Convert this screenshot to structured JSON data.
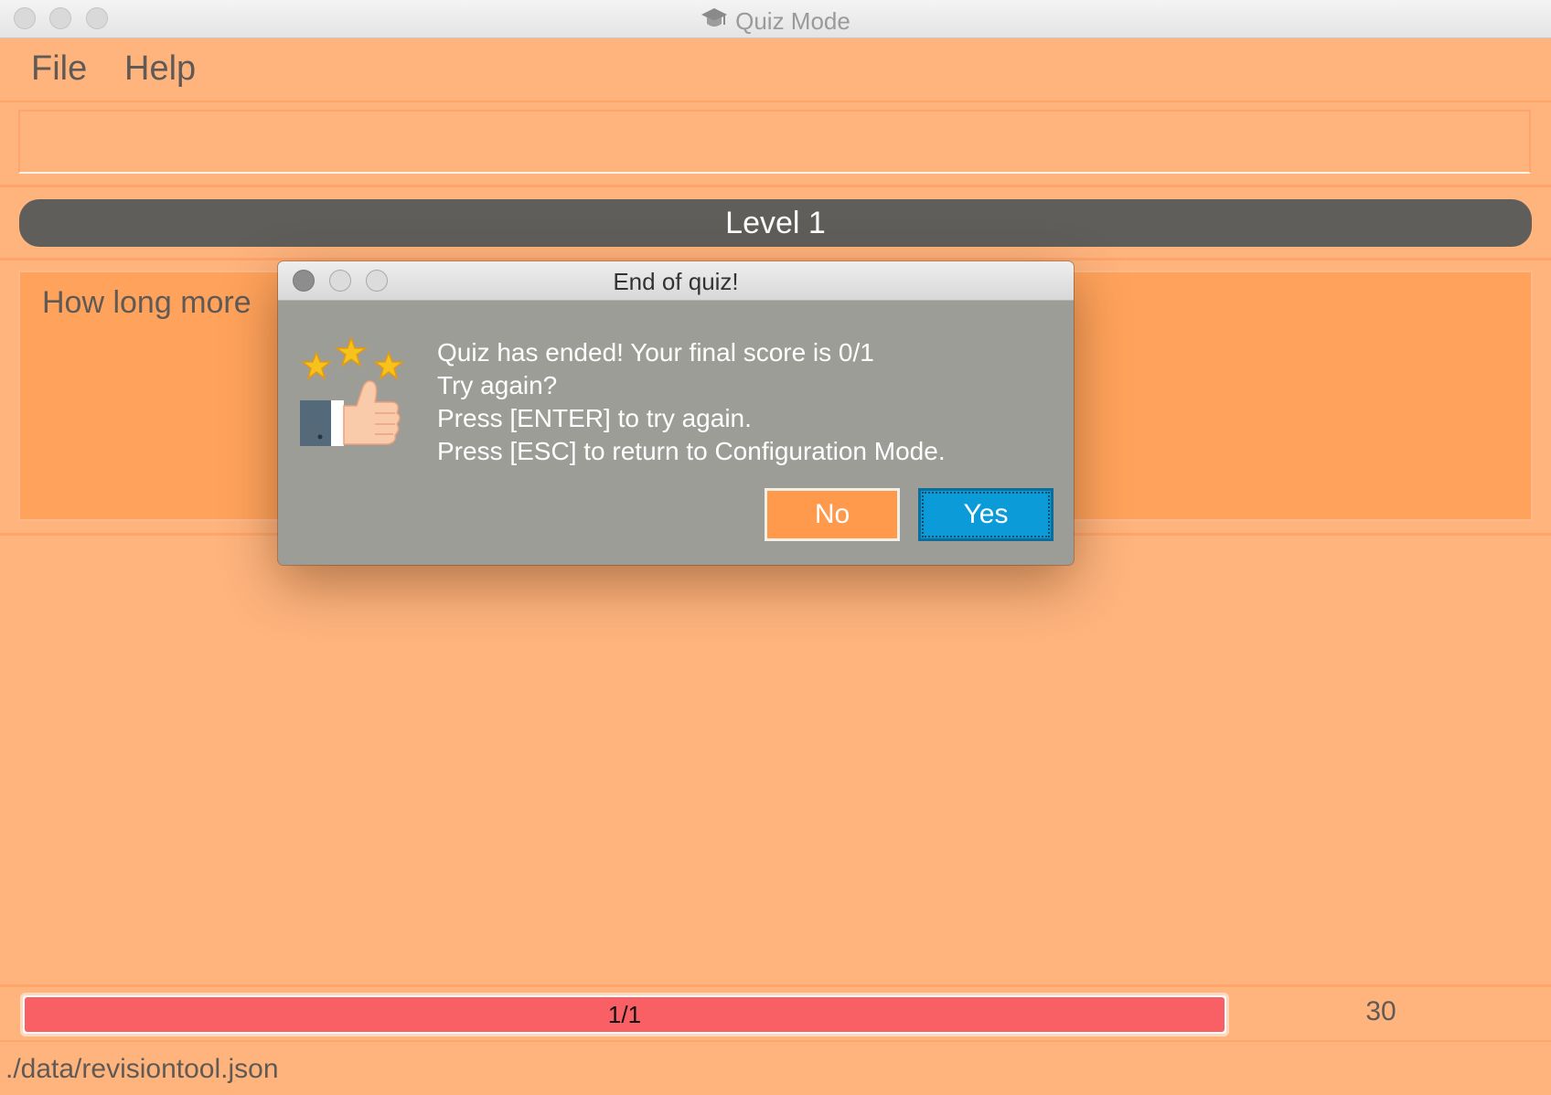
{
  "window": {
    "title": "Quiz Mode",
    "app_icon": "graduation-cap-icon"
  },
  "menu": {
    "file": "File",
    "help": "Help"
  },
  "command_box": {
    "value": "",
    "placeholder": ""
  },
  "level": {
    "label": "Level 1"
  },
  "question": {
    "text": "How long more"
  },
  "progress": {
    "label": "1/1",
    "fraction": 1.0
  },
  "timer": {
    "value": "30"
  },
  "status": {
    "file_path": "./data/revisiontool.json"
  },
  "dialog": {
    "title": "End of quiz!",
    "icon": "thumbs-up-stars-icon",
    "lines": [
      "Quiz has ended! Your final score is 0/1",
      "Try again?",
      "Press [ENTER] to try again.",
      "Press [ESC] to return to Configuration Mode."
    ],
    "no_label": "No",
    "yes_label": "Yes"
  },
  "colors": {
    "background": "#ffb47d",
    "level_bar": "#5f5e5a",
    "progress_fill": "#f96065",
    "yes_button": "#0a9bd8",
    "no_button": "#ff9a4d"
  }
}
